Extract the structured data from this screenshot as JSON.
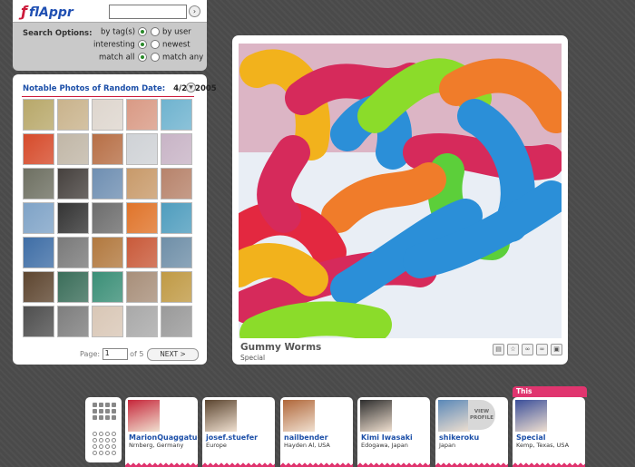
{
  "app": {
    "logo_text": "flAppr",
    "search_placeholder": "",
    "go_icon": "arrow-right-icon"
  },
  "search_options": {
    "title": "Search Options:",
    "by_tags": "by tag(s)",
    "by_user": "by user",
    "interesting": "interesting",
    "newest": "newest",
    "match_all": "match all",
    "match_any": "match any"
  },
  "notable": {
    "heading": "Notable Photos of Random Date:",
    "date": "4/21/2005",
    "thumb_colors": [
      "#b8a86a",
      "#c9b38c",
      "#ded6ce",
      "#d99a85",
      "#6fb3cf",
      "#d64b2b",
      "#c1b7a7",
      "#b76f46",
      "#cfd2d6",
      "#c8b4c6",
      "#6e7062",
      "#46413e",
      "#6f8fb2",
      "#c89a6a",
      "#b7836b",
      "#7fa3c7",
      "#343434",
      "#6d6d6d",
      "#e0742a",
      "#4f9dbe",
      "#3f6ea6",
      "#7a7a7a",
      "#b2793f",
      "#c95a3a",
      "#6f8fa8",
      "#5e4630",
      "#3b6e5a",
      "#3b8f77",
      "#a88f7a",
      "#c09a45",
      "#4f4f4f",
      "#7e7e7e",
      "#d9c7b6",
      "#a9a9a9",
      "#9a9a9a"
    ],
    "page_label": "Page:",
    "page_value": "1",
    "page_of": "of 5",
    "next_label": "NEXT >"
  },
  "photo": {
    "title": "Gummy Worms",
    "author": "Special",
    "tools": [
      "page-icon",
      "star-icon",
      "link-icon",
      "link-icon",
      "save-icon"
    ]
  },
  "photographers": [
    {
      "name": "MarionQuaggatuggu",
      "location": "Nrnberg, Germany",
      "color": "#c6263a",
      "view_profile": ""
    },
    {
      "name": "josef.stuefer",
      "location": "Europe",
      "color": "#5b4530",
      "view_profile": ""
    },
    {
      "name": "nailbender",
      "location": "Hayden Al, USA",
      "color": "#b0673a",
      "view_profile": ""
    },
    {
      "name": "Kimi Iwasaki",
      "location": "Edogawa, Japan",
      "color": "#2e2e2e",
      "view_profile": ""
    },
    {
      "name": "shikeroku",
      "location": "Japan",
      "color": "#5a88b8",
      "view_profile": "VIEW PROFILE"
    },
    {
      "name": "Special",
      "location": "Kemp, Texas, USA",
      "color": "#3b4f9a",
      "view_profile": ""
    }
  ],
  "this_photographer_label": "This Photographer"
}
